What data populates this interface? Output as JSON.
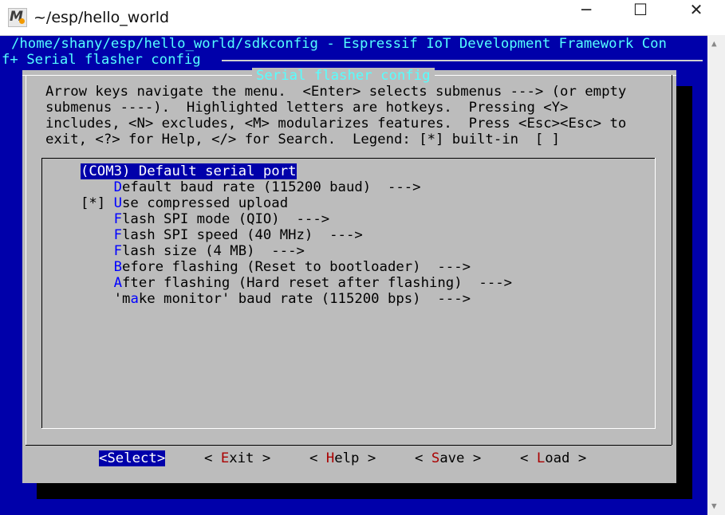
{
  "window": {
    "title": "~/esp/hello_world",
    "minimize_glyph": "─",
    "maximize_glyph": "☐",
    "close_glyph": "✕"
  },
  "header": {
    "path_line": "/home/shany/esp/hello_world/sdkconfig - Espressif IoT Development Framework Con",
    "breadcrumb": "f+ Serial flasher config "
  },
  "dialog": {
    "title": "Serial flasher config",
    "help_lines": [
      "Arrow keys navigate the menu.  <Enter> selects submenus ---> (or empty",
      "submenus ----).  Highlighted letters are hotkeys.  Pressing <Y>",
      "includes, <N> excludes, <M> modularizes features.  Press <Esc><Esc> to",
      "exit, <?> for Help, </> for Search.  Legend: [*] built-in  [ ]"
    ]
  },
  "menu": {
    "items": [
      {
        "prefix": "",
        "text": "(COM3) Default serial port",
        "selected": true
      },
      {
        "prefix": "    ",
        "hotkey": "D",
        "rest": "efault baud rate (115200 baud)  --->"
      },
      {
        "prefix": "[*] ",
        "hotkey": "U",
        "rest": "se compressed upload"
      },
      {
        "prefix": "    ",
        "hotkey": "F",
        "rest": "lash SPI mode (QIO)  --->"
      },
      {
        "prefix": "    ",
        "hotkey": "F",
        "rest": "lash SPI speed (40 MHz)  --->"
      },
      {
        "prefix": "    ",
        "hotkey": "F",
        "rest": "lash size (4 MB)  --->"
      },
      {
        "prefix": "    ",
        "hotkey": "B",
        "rest": "efore flashing (Reset to bootloader)  --->"
      },
      {
        "prefix": "    ",
        "hotkey": "A",
        "rest": "fter flashing (Hard reset after flashing)  --->"
      },
      {
        "prefix": "    ",
        "pre_hotkey": "'m",
        "hotkey": "a",
        "rest": "ke monitor' baud rate (115200 bps)  --->"
      }
    ]
  },
  "buttons": {
    "select": "<Select>",
    "exit": {
      "open": "< ",
      "hotkey": "E",
      "rest": "xit >"
    },
    "help": {
      "open": "< ",
      "hotkey": "H",
      "rest": "elp >"
    },
    "save": {
      "open": "< ",
      "hotkey": "S",
      "rest": "ave >"
    },
    "load": {
      "open": "< ",
      "hotkey": "L",
      "rest": "oad >"
    }
  },
  "colors": {
    "terminal_bg": "#0000aa",
    "dialog_bg": "#bcbcbc",
    "title_text": "#55ffff",
    "hotkey": "#0000ff",
    "button_hotkey": "#aa0000"
  }
}
